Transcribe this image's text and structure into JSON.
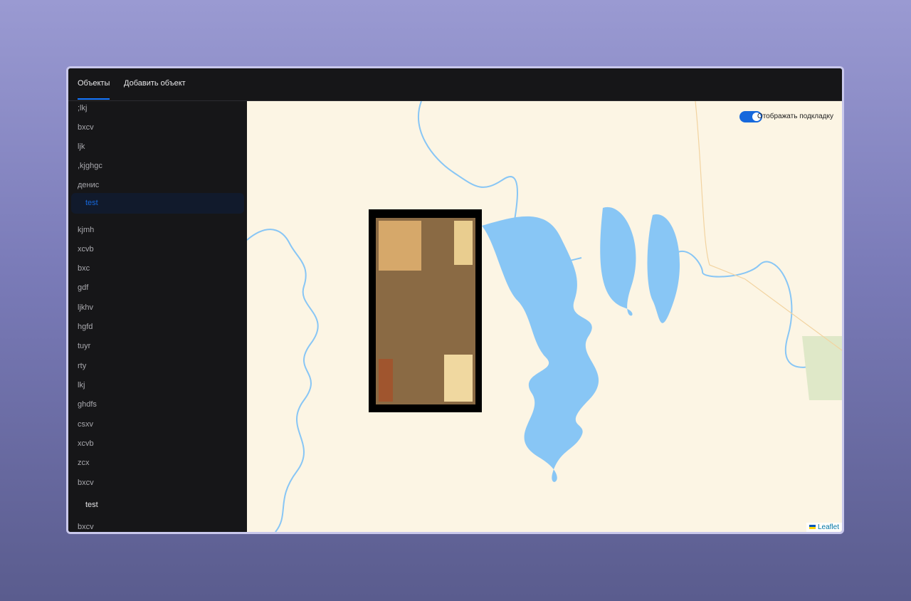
{
  "header": {
    "tabs": [
      {
        "label": "Объекты",
        "active": true
      },
      {
        "label": "Добавить объект",
        "active": false
      }
    ]
  },
  "sidebar": {
    "items": [
      ";lkj",
      "bxcv",
      "ljk",
      ",kjghgc",
      "денис",
      "test",
      "kjmh",
      "xcvb",
      "bxc",
      "gdf",
      "ljkhv",
      "hgfd",
      "tuyr",
      "rty",
      "lkj",
      "ghdfs",
      "csxv",
      "xcvb",
      "zcx",
      "bxcv",
      "test",
      "bxcv"
    ],
    "selected_index": 5
  },
  "map": {
    "toggle_label": "Отображать подкладку",
    "toggle_on": true,
    "attribution": "Leaflet",
    "colors": {
      "land": "#fcf5e4",
      "water": "#88c6f5",
      "accent": "#1668dc"
    }
  }
}
